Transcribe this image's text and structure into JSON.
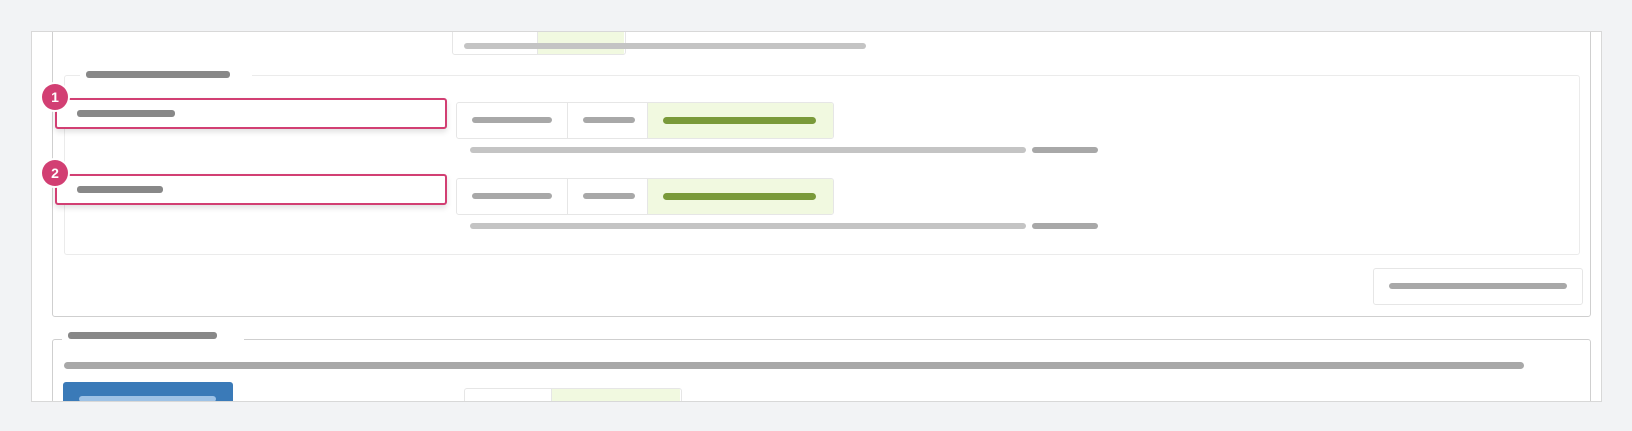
{
  "markers": [
    "1",
    "2"
  ],
  "accent_colors": {
    "marker": "#d23f73",
    "active_segment": "#f1f9e0",
    "active_segment_text": "#7a9a3a",
    "primary_button": "#3a7ab8"
  }
}
